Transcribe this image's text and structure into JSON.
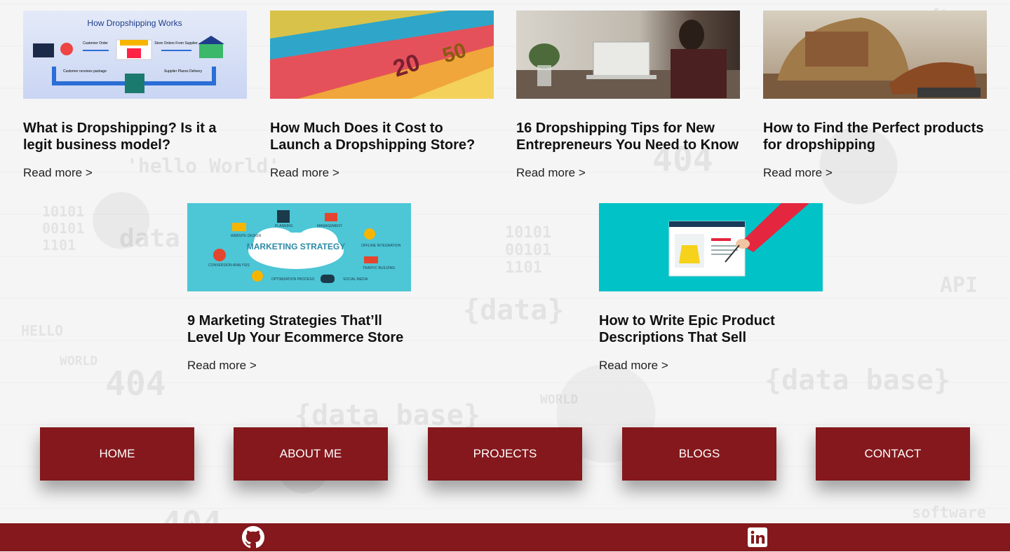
{
  "posts": [
    {
      "title": "What is Dropshipping? Is it a legit business model?",
      "read_more": "Read more >",
      "diagram": {
        "heading": "How Dropshipping Works",
        "steps": [
          "Customer Order",
          "Store Orders From Supplier",
          "Supplier Places Delivery",
          "Customer receives package"
        ]
      }
    },
    {
      "title": "How Much Does it Cost to Launch a Dropshipping Store?",
      "read_more": "Read more >"
    },
    {
      "title": "16 Dropshipping Tips for New Entrepreneurs You Need to Know",
      "read_more": "Read more >"
    },
    {
      "title": "How to Find the Perfect products for dropshipping",
      "read_more": "Read more >"
    },
    {
      "title": "9 Marketing Strategies That’ll Level Up Your Ecommerce Store",
      "read_more": "Read more >",
      "graphic": {
        "center": "MARKETING STRATEGY",
        "labels": [
          "WEBSITE DESIGN",
          "PLANNING",
          "MANAGEMENT",
          "OFFLINE INTEGRATION",
          "CONVERSION ANALYSIS",
          "TRAFFIC BUILDING",
          "OPTIMIZATION PROCESS",
          "SOCIAL MEDIA"
        ]
      }
    },
    {
      "title": "How to Write Epic Product Descriptions That Sell",
      "read_more": "Read more >"
    }
  ],
  "nav": [
    "HOME",
    "ABOUT ME",
    "PROJECTS",
    "BLOGS",
    "CONTACT"
  ],
  "footer": {
    "icons": [
      "github-icon",
      "linkedin-icon"
    ]
  },
  "colors": {
    "brand": "#84181c",
    "teal": "#00c2c7",
    "sky": "#4dc6d6"
  }
}
